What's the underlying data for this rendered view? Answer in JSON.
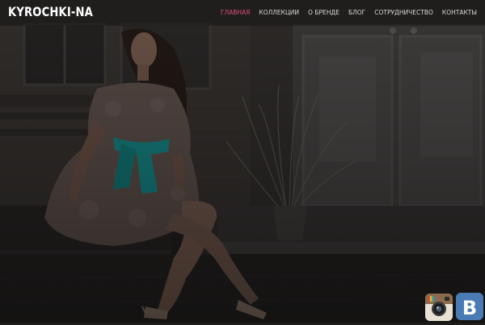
{
  "site": {
    "logo": "KYROCHKI-NA"
  },
  "nav": {
    "items": [
      {
        "label": "ГЛАВНАЯ",
        "active": true
      },
      {
        "label": "КОЛЛЕКЦИИ",
        "active": false
      },
      {
        "label": "О БРЕНДЕ",
        "active": false
      },
      {
        "label": "БЛОГ",
        "active": false
      },
      {
        "label": "СОТРУДНИЧЕСТВО",
        "active": false
      },
      {
        "label": "КОНТАКТЫ",
        "active": false
      }
    ]
  },
  "social": {
    "icons": [
      "instagram-icon",
      "vk-icon"
    ],
    "vk_glyph": "B"
  },
  "colors": {
    "accent": "#e0507a",
    "vk_blue": "#4a7bb5",
    "sash": "#1a9e9e"
  }
}
